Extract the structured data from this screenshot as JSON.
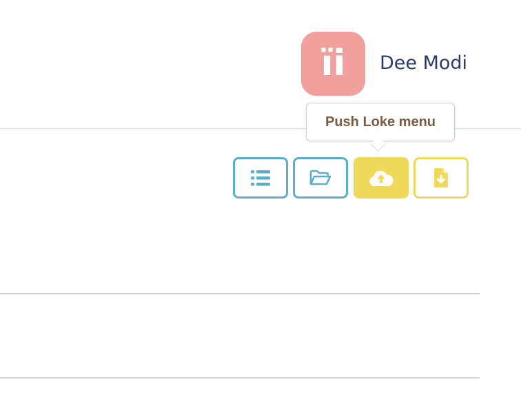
{
  "user": {
    "avatar_initials": "ïi",
    "name": "Dee Modi",
    "avatar_color": "#f2a09d"
  },
  "toolbar": {
    "buttons": [
      {
        "icon": "list-icon",
        "style": "blue-outline"
      },
      {
        "icon": "folder-open-icon",
        "style": "blue-outline"
      },
      {
        "icon": "cloud-upload-icon",
        "style": "yellow-filled",
        "hovered": true
      },
      {
        "icon": "file-download-icon",
        "style": "yellow-outline"
      }
    ],
    "tooltip": "Push Loke menu"
  },
  "colors": {
    "blue_accent": "#5aaec8",
    "yellow_accent": "#f0d85a",
    "tooltip_text": "#7a5c42",
    "name_text": "#2b3a6b"
  }
}
